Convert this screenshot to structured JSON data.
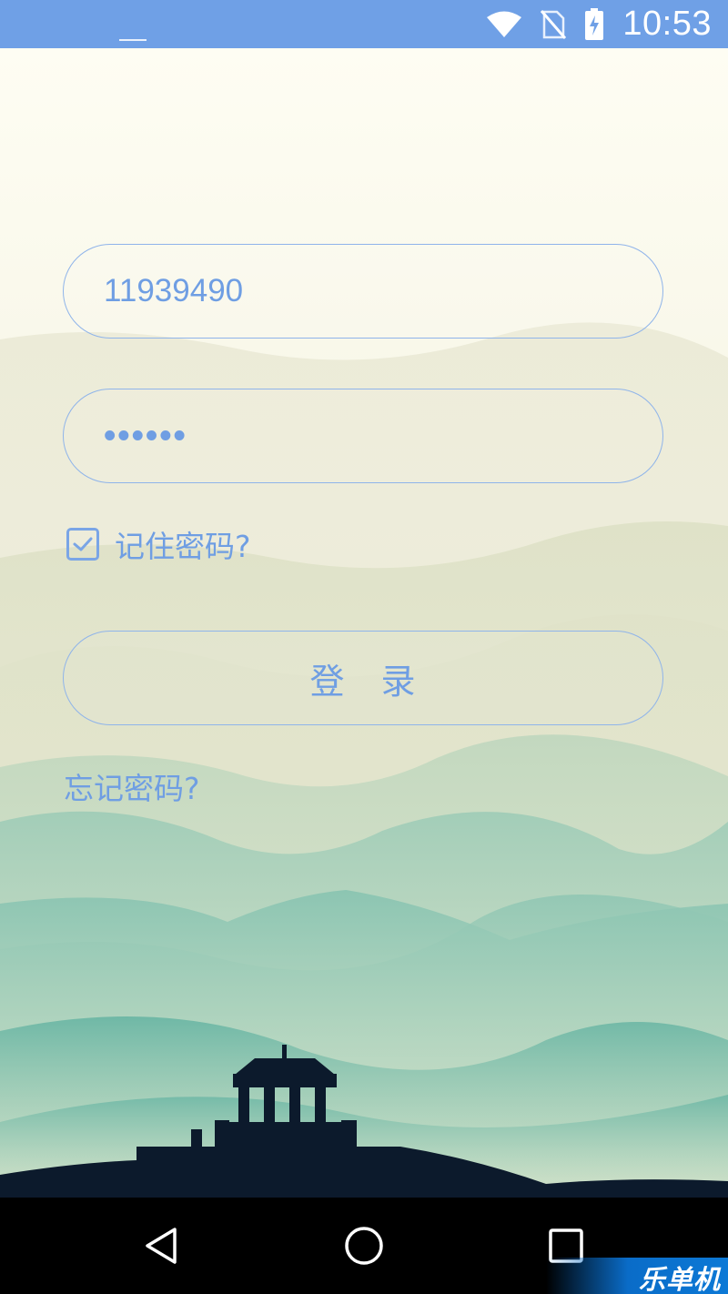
{
  "status_bar": {
    "time": "10:53",
    "icons": [
      "wifi-icon",
      "no-sim-icon",
      "battery-charging-icon"
    ]
  },
  "login_form": {
    "username_value": "11939490",
    "password_value": "••••••",
    "remember_label": "记住密码?",
    "remember_checked": true,
    "login_button_label": "登　录",
    "forgot_password_label": "忘记密码?"
  },
  "nav_bar": {
    "icons": [
      "back-icon",
      "home-icon",
      "recents-icon"
    ]
  },
  "watermark": {
    "text": "乐单机"
  },
  "colors": {
    "accent": "#6f9ee3",
    "status_bar": "#6fa0e6",
    "background": "#fdfcf1",
    "mountain_green": "#7cbca9",
    "silhouette": "#0c1a2c"
  }
}
